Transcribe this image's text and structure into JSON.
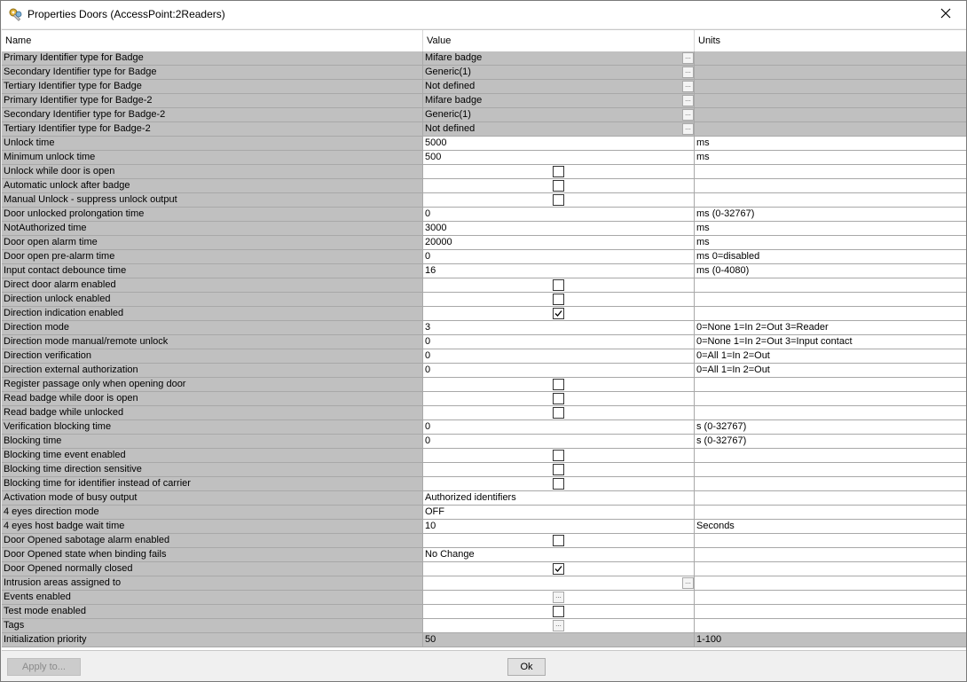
{
  "window": {
    "title": "Properties Doors (AccessPoint:2Readers)"
  },
  "grid": {
    "headers": {
      "name": "Name",
      "value": "Value",
      "units": "Units"
    },
    "rows": [
      {
        "name": "Primary Identifier type for Badge",
        "value": "Mifare badge",
        "units": "",
        "kind": "dropdown",
        "selected": true
      },
      {
        "name": "Secondary Identifier type for Badge",
        "value": "Generic(1)",
        "units": "",
        "kind": "dropdown",
        "selected": true
      },
      {
        "name": "Tertiary Identifier type for Badge",
        "value": "Not defined",
        "units": "",
        "kind": "dropdown",
        "selected": true
      },
      {
        "name": "Primary Identifier type for Badge-2",
        "value": "Mifare badge",
        "units": "",
        "kind": "dropdown",
        "selected": true
      },
      {
        "name": "Secondary Identifier type for Badge-2",
        "value": "Generic(1)",
        "units": "",
        "kind": "dropdown",
        "selected": true
      },
      {
        "name": "Tertiary Identifier type for Badge-2",
        "value": "Not defined",
        "units": "",
        "kind": "dropdown",
        "selected": true
      },
      {
        "name": "Unlock time",
        "value": "5000",
        "units": "ms",
        "kind": "text"
      },
      {
        "name": "Minimum unlock time",
        "value": "500",
        "units": "ms",
        "kind": "text"
      },
      {
        "name": "Unlock while door is open",
        "value": "",
        "units": "",
        "kind": "checkbox",
        "checked": false
      },
      {
        "name": "Automatic unlock after badge",
        "value": "",
        "units": "",
        "kind": "checkbox",
        "checked": false
      },
      {
        "name": "Manual Unlock - suppress unlock output",
        "value": "",
        "units": "",
        "kind": "checkbox",
        "checked": false
      },
      {
        "name": "Door unlocked prolongation time",
        "value": "0",
        "units": "ms (0-32767)",
        "kind": "text"
      },
      {
        "name": "NotAuthorized time",
        "value": "3000",
        "units": "ms",
        "kind": "text"
      },
      {
        "name": "Door open alarm time",
        "value": "20000",
        "units": "ms",
        "kind": "text"
      },
      {
        "name": "Door open pre-alarm time",
        "value": "0",
        "units": "ms 0=disabled",
        "kind": "text"
      },
      {
        "name": "Input contact debounce time",
        "value": "16",
        "units": "ms (0-4080)",
        "kind": "text"
      },
      {
        "name": "Direct door alarm enabled",
        "value": "",
        "units": "",
        "kind": "checkbox",
        "checked": false
      },
      {
        "name": "Direction unlock enabled",
        "value": "",
        "units": "",
        "kind": "checkbox",
        "checked": false
      },
      {
        "name": "Direction indication enabled",
        "value": "",
        "units": "",
        "kind": "checkbox",
        "checked": true
      },
      {
        "name": "Direction mode",
        "value": "3",
        "units": "0=None 1=In 2=Out 3=Reader",
        "kind": "text"
      },
      {
        "name": "Direction mode manual/remote unlock",
        "value": "0",
        "units": "0=None 1=In 2=Out 3=Input contact",
        "kind": "text"
      },
      {
        "name": "Direction verification",
        "value": "0",
        "units": "0=All 1=In 2=Out",
        "kind": "text"
      },
      {
        "name": "Direction external authorization",
        "value": "0",
        "units": "0=All 1=In 2=Out",
        "kind": "text"
      },
      {
        "name": "Register passage only when opening door",
        "value": "",
        "units": "",
        "kind": "checkbox",
        "checked": false
      },
      {
        "name": "Read badge while door is open",
        "value": "",
        "units": "",
        "kind": "checkbox",
        "checked": false
      },
      {
        "name": "Read badge while unlocked",
        "value": "",
        "units": "",
        "kind": "checkbox",
        "checked": false
      },
      {
        "name": "Verification blocking time",
        "value": "0",
        "units": "s (0-32767)",
        "kind": "text"
      },
      {
        "name": "Blocking time",
        "value": "0",
        "units": "s (0-32767)",
        "kind": "text"
      },
      {
        "name": "Blocking time event enabled",
        "value": "",
        "units": "",
        "kind": "checkbox",
        "checked": false
      },
      {
        "name": "Blocking time direction sensitive",
        "value": "",
        "units": "",
        "kind": "checkbox",
        "checked": false
      },
      {
        "name": "Blocking time for identifier instead of carrier",
        "value": "",
        "units": "",
        "kind": "checkbox",
        "checked": false
      },
      {
        "name": "Activation mode of busy output",
        "value": "Authorized identifiers",
        "units": "",
        "kind": "text"
      },
      {
        "name": "4 eyes direction mode",
        "value": "OFF",
        "units": "",
        "kind": "text"
      },
      {
        "name": "4 eyes host badge wait time",
        "value": "10",
        "units": "Seconds",
        "kind": "text"
      },
      {
        "name": "Door Opened sabotage alarm enabled",
        "value": "",
        "units": "",
        "kind": "checkbox",
        "checked": false
      },
      {
        "name": "Door Opened state when binding fails",
        "value": "No Change",
        "units": "",
        "kind": "text"
      },
      {
        "name": "Door Opened normally closed",
        "value": "",
        "units": "",
        "kind": "checkbox",
        "checked": true
      },
      {
        "name": "Intrusion areas assigned to",
        "value": "",
        "units": "",
        "kind": "dropdown"
      },
      {
        "name": "Events enabled",
        "value": "",
        "units": "",
        "kind": "ellipsis-center"
      },
      {
        "name": "Test mode enabled",
        "value": "",
        "units": "",
        "kind": "checkbox",
        "checked": false
      },
      {
        "name": "Tags",
        "value": "",
        "units": "",
        "kind": "ellipsis-center"
      },
      {
        "name": "Initialization priority",
        "value": "50",
        "units": "1-100",
        "kind": "text",
        "selected": true
      }
    ]
  },
  "footer": {
    "apply_label": "Apply to...",
    "ok_label": "Ok"
  },
  "colors": {
    "name_column": "#c0c0c0",
    "grid_line": "#a8a8a8",
    "window_bg": "#f0f0f0"
  },
  "icons": {
    "app": "keys-icon",
    "close": "close-icon",
    "ellipsis": "ellipsis-button"
  }
}
